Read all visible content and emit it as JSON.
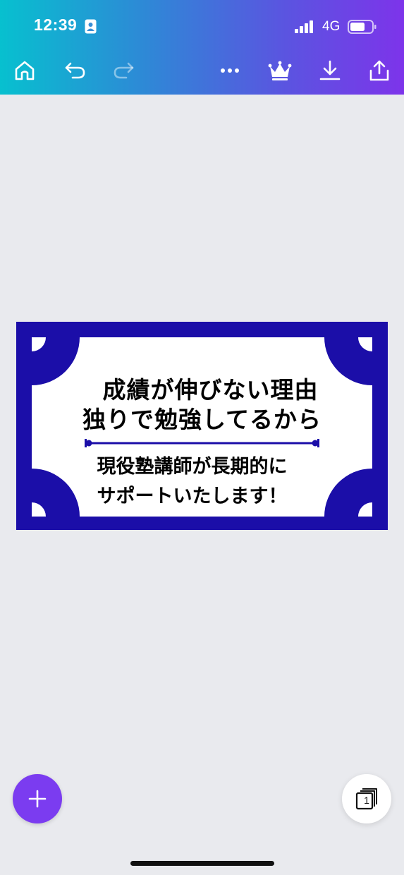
{
  "status_bar": {
    "time": "12:39",
    "network": "4G",
    "icons": [
      "person-icon",
      "signal-icon",
      "battery-icon"
    ]
  },
  "toolbar": {
    "icons": [
      "home-icon",
      "undo-icon",
      "redo-icon",
      "more-icon",
      "crown-icon",
      "download-icon",
      "share-icon"
    ],
    "redo_enabled": false
  },
  "design": {
    "line1": "成績が伸びない理由",
    "line2": "独りで勉強してるから",
    "line3": "現役塾講師が長期的に",
    "line4": "サポートいたします！",
    "colors": {
      "frame": "#1b0ea8",
      "panel": "#ffffff",
      "text": "#000000"
    }
  },
  "fab": {
    "icon": "plus-icon",
    "color": "#7b3cf0"
  },
  "pages": {
    "icon": "pages-icon",
    "count": "1"
  },
  "colors": {
    "gradient_start": "#07c0cf",
    "gradient_end": "#7d34ea",
    "canvas_bg": "#e9eaee"
  }
}
